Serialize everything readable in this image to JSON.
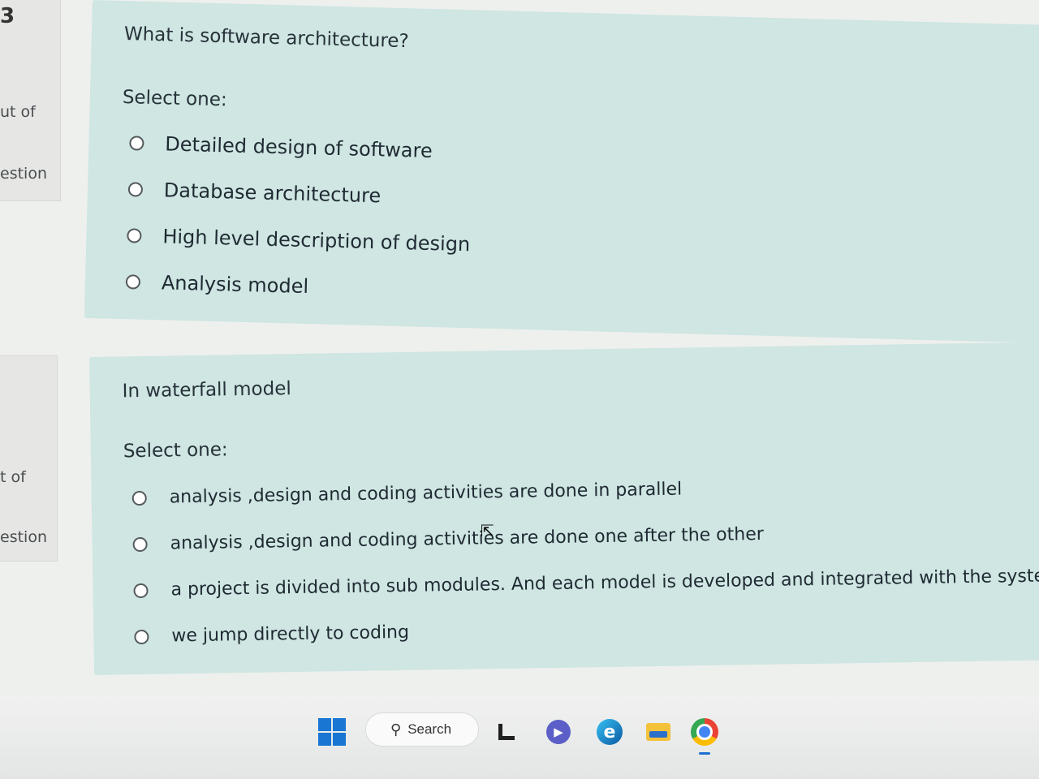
{
  "sidebar": {
    "question1": {
      "number": "3",
      "out_of": "ut of",
      "question": "estion"
    },
    "question2": {
      "number": "",
      "out_of": "t of",
      "question": "estion"
    }
  },
  "questions": [
    {
      "text": "What is software architecture?",
      "prompt": "Select one:",
      "options": [
        "Detailed design of software",
        "Database architecture",
        "High level description of design",
        "Analysis model"
      ]
    },
    {
      "text": "In waterfall model",
      "prompt": "Select one:",
      "options": [
        "analysis ,design and coding activities are done in parallel",
        "analysis ,design and coding activities are done one after the other",
        "a project is divided into sub modules. And each model is developed and integrated with the system",
        "we jump directly to coding"
      ]
    }
  ],
  "taskbar": {
    "search_label": "Search",
    "icons": [
      "windows-start-icon",
      "search-icon",
      "task-view-icon",
      "meet-icon",
      "edge-icon",
      "file-explorer-icon",
      "chrome-icon"
    ]
  },
  "colors": {
    "card_bg": "#cfe6e2",
    "page_bg": "#eef0ee",
    "windows_blue": "#1976d2"
  }
}
